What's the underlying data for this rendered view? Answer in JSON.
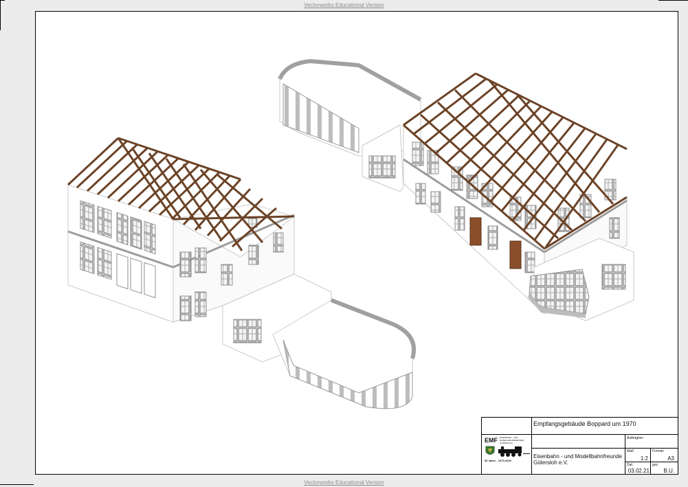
{
  "watermark": "Vectorworks Educational Version",
  "title_block": {
    "drawing_title": "Empfangsgebäude Boppard um 1970",
    "auftraggeber_label": "Auftragher:",
    "club_name_line1": "Eisenbahn - und Modellbahnfreunde",
    "club_name_line2": "Gütersloh e.V.",
    "scale_label": "Maß",
    "scale_value": "1:2",
    "format_label": "Format:",
    "format_value": "A3",
    "date_label": "Dat:",
    "date_value": "03.02.21",
    "drawn_label": "gez:",
    "drawn_value": "B.U.",
    "logo": {
      "abbrev": "EMF",
      "line1": "EISENBAHN - UND",
      "line2": "MODELLBAHNFREUNDE",
      "line3": "GÜTERSLOH",
      "anniversary": "50 Jahre  -  1970-2020",
      "icons": [
        "crest-icon",
        "locomotive-icon"
      ]
    }
  },
  "colors": {
    "roof_beam": "#6b4226",
    "wall": "#ffffff",
    "window_frame": "#8f8f8f",
    "wall_shadow": "#cfcfcf",
    "door": "#8a4f2a"
  }
}
